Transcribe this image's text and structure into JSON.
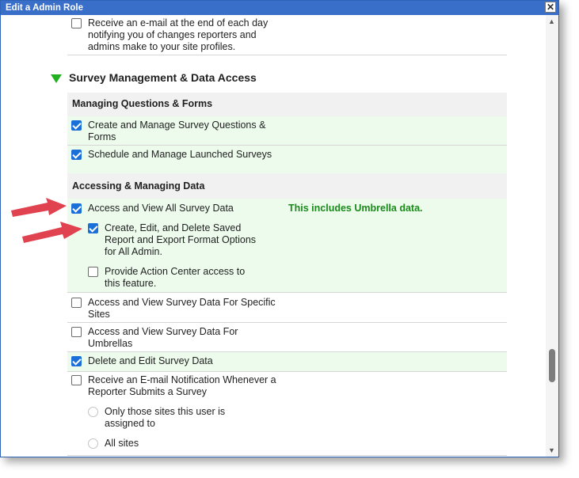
{
  "dialog": {
    "title": "Edit a Admin Role",
    "close_symbol": "✕"
  },
  "items": {
    "receive_email_changes": "Receive an e-mail at the end of each day notifying you of changes reporters and admins make to your site profiles.",
    "section_title": "Survey Management & Data Access",
    "managing_questions_header": "Managing Questions & Forms",
    "create_manage_questions": "Create and Manage Survey Questions & Forms",
    "schedule_launched": "Schedule and Manage Launched Surveys",
    "accessing_data_header": "Accessing & Managing Data",
    "access_view_all": "Access and View All Survey Data",
    "umbrella_note": "This includes Umbrella data.",
    "create_edit_delete_saved": "Create, Edit, and Delete Saved Report and Export Format Options for All Admin.",
    "action_center_access": "Provide Action Center access to this feature.",
    "access_specific_sites": "Access and View Survey Data For Specific Sites",
    "access_umbrellas": "Access and View Survey Data For Umbrellas",
    "delete_edit": "Delete and Edit Survey Data",
    "receive_notification": "Receive an E-mail Notification Whenever a Reporter Submits a Survey",
    "only_those_sites": "Only those sites this user is assigned to",
    "all_sites": "All sites"
  },
  "colors": {
    "title_bar": "#3a6fc9",
    "checked": "#1a6fd8",
    "highlight": "#ecfbec",
    "note": "#1a8a1a",
    "arrow": "#e0424f"
  }
}
